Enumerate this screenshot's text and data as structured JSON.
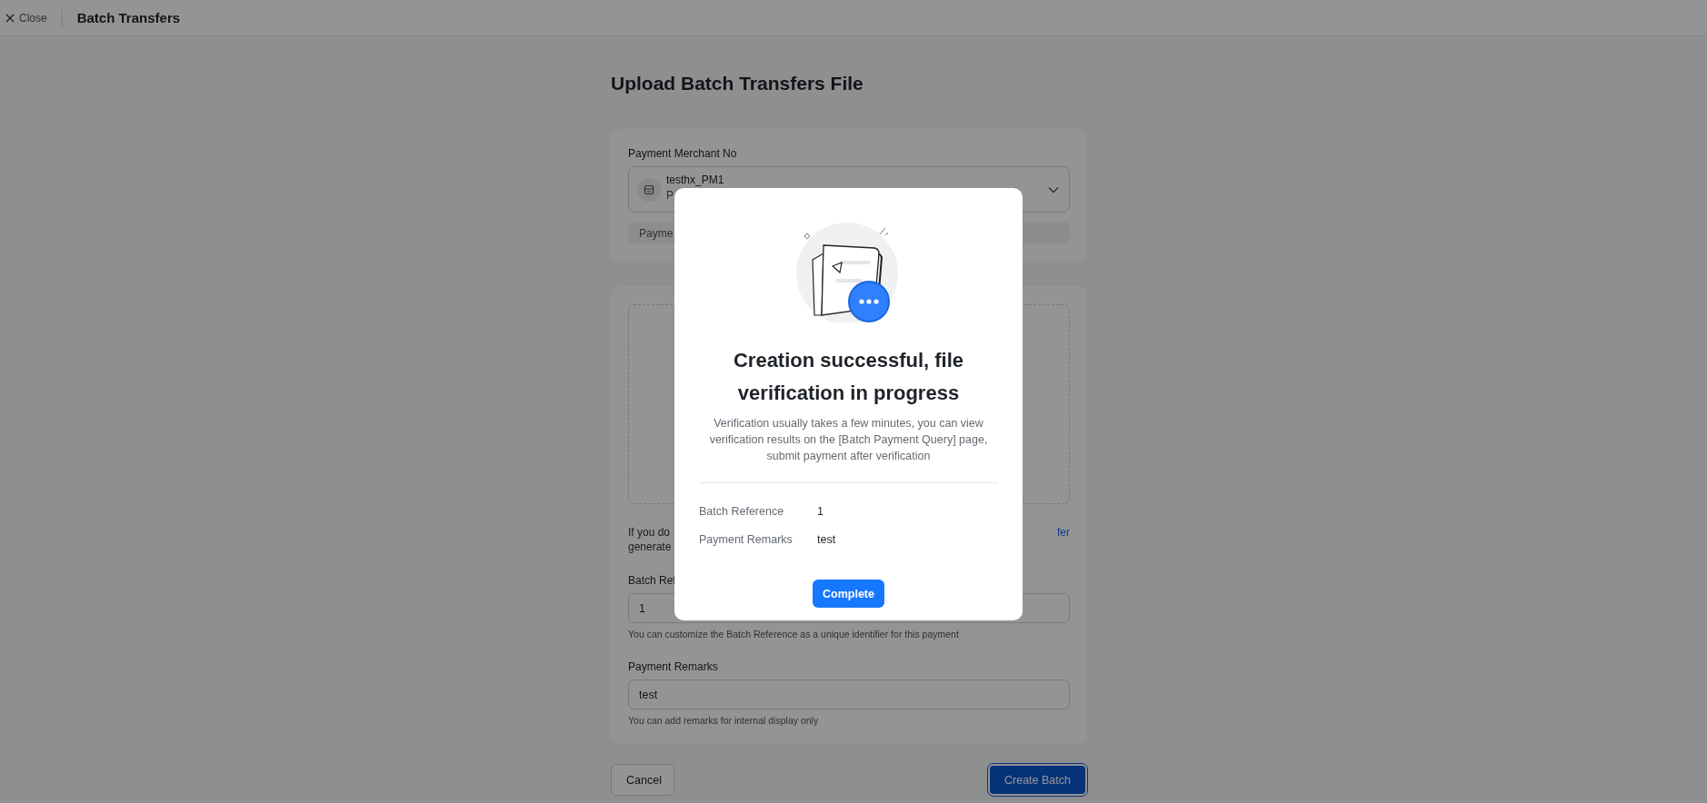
{
  "header": {
    "close": "Close",
    "title": "Batch Transfers"
  },
  "page_title": "Upload Batch Transfers File",
  "merchant_card": {
    "label": "Payment Merchant No",
    "select": {
      "name": "testhx_PM1",
      "sub": "P"
    },
    "info": "Payme"
  },
  "upload_card": {
    "hint_lines": [
      "If you do",
      "generate"
    ],
    "hint_link": "fer",
    "fields": [
      {
        "label": "Batch Ref",
        "value": "1",
        "help": "You can customize the Batch Reference as a unique identifier for this payment"
      },
      {
        "label": "Payment Remarks",
        "value": "test",
        "help": "You can add remarks for internal display only"
      }
    ]
  },
  "footer": {
    "cancel": "Cancel",
    "create": "Create Batch"
  },
  "modal": {
    "title": "Creation successful, file verification in progress",
    "description": "Verification usually takes a few minutes, you can view verification results on the [Batch Payment Query] page, submit payment after verification",
    "details": [
      {
        "label": "Batch Reference",
        "value": "1"
      },
      {
        "label": "Payment Remarks",
        "value": "test"
      }
    ],
    "button": "Complete"
  }
}
